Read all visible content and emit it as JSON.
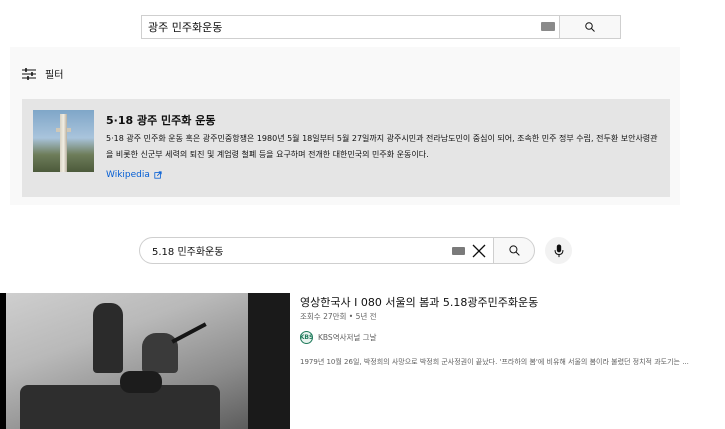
{
  "search_top": {
    "query": "광주 민주화운동",
    "keyboard_icon": "keyboard-icon",
    "search_icon": "search-icon"
  },
  "filter": {
    "icon": "filter-sliders-icon",
    "label": "필터"
  },
  "knowledge_panel": {
    "title": "5·18 광주 민주화 운동",
    "description": "5·18 광주 민주화 운동 혹은 광주민중항쟁은 1980년 5월 18일부터 5월 27일까지 광주시민과 전라남도민이 중심이 되어, 조속한 민주 정부 수립, 전두환 보안사령관을 비롯한 신군부 세력의 퇴진 및 계엄령 철폐 등을 요구하며 전개한 대한민국의 민주화 운동이다.",
    "source_link": "Wikipedia",
    "source_icon": "external-link-icon"
  },
  "search_bottom": {
    "query": "5.18 민주화운동",
    "keyboard_icon": "keyboard-icon",
    "clear_icon": "close-icon",
    "search_icon": "search-icon",
    "mic_icon": "microphone-icon"
  },
  "video": {
    "title": "영상한국사 I 080 서울의 봄과 5.18광주민주화운동",
    "meta": "조회수 27만회 • 5년 전",
    "channel_name": "KBS역사저널 그날",
    "channel_avatar": "KBS",
    "description": "1979년 10월 26일, 박정희의 사망으로 박정희 군사정권이 끝났다. '프라하의 봄'에 비유해 서울의 봄이라 불렸던 정치적 과도기는 ..."
  },
  "colors": {
    "link": "#065fd4",
    "panel_bg": "#e5e5e5",
    "secondary_text": "#606060"
  }
}
